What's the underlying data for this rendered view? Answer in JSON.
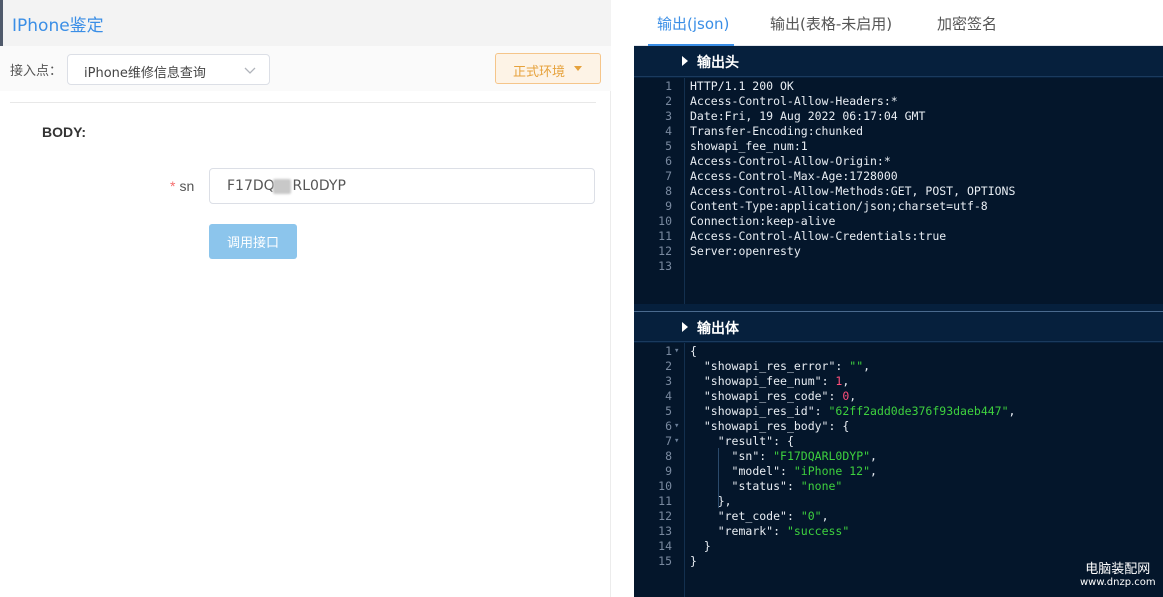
{
  "app": {
    "title": "IPhone鉴定"
  },
  "endpoint": {
    "label": "接入点：",
    "selected": "iPhone维修信息查询"
  },
  "env_button": {
    "label": "正式环境"
  },
  "form": {
    "section_label": "BODY:",
    "required_mark": "*",
    "sn_label": "sn",
    "sn_value": "F17DQ    RL0DYP",
    "submit_label": "调用接口"
  },
  "tabs": [
    "输出(json)",
    "输出(表格-未启用)",
    "加密签名"
  ],
  "output_head": {
    "title": "输出头",
    "lines": [
      "HTTP/1.1 200 OK",
      "Access-Control-Allow-Headers:*",
      "Date:Fri, 19 Aug 2022 06:17:04 GMT",
      "Transfer-Encoding:chunked",
      "showapi_fee_num:1",
      "Access-Control-Allow-Origin:*",
      "Access-Control-Max-Age:1728000",
      "Access-Control-Allow-Methods:GET, POST, OPTIONS",
      "Content-Type:application/json;charset=utf-8",
      "Connection:keep-alive",
      "Access-Control-Allow-Credentials:true",
      "Server:openresty",
      ""
    ]
  },
  "output_body": {
    "title": "输出体",
    "lines": [
      {
        "fold": true,
        "parts": [
          [
            "p",
            "{"
          ]
        ]
      },
      {
        "fold": false,
        "parts": [
          [
            "p",
            "  "
          ],
          [
            "k",
            "\"showapi_res_error\""
          ],
          [
            "p",
            ": "
          ],
          [
            "s",
            "\"\""
          ],
          [
            "p",
            ","
          ]
        ]
      },
      {
        "fold": false,
        "parts": [
          [
            "p",
            "  "
          ],
          [
            "k",
            "\"showapi_fee_num\""
          ],
          [
            "p",
            ": "
          ],
          [
            "n",
            "1"
          ],
          [
            "p",
            ","
          ]
        ]
      },
      {
        "fold": false,
        "parts": [
          [
            "p",
            "  "
          ],
          [
            "k",
            "\"showapi_res_code\""
          ],
          [
            "p",
            ": "
          ],
          [
            "n",
            "0"
          ],
          [
            "p",
            ","
          ]
        ]
      },
      {
        "fold": false,
        "parts": [
          [
            "p",
            "  "
          ],
          [
            "k",
            "\"showapi_res_id\""
          ],
          [
            "p",
            ": "
          ],
          [
            "s",
            "\"62ff2add0de376f93daeb447\""
          ],
          [
            "p",
            ","
          ]
        ]
      },
      {
        "fold": true,
        "parts": [
          [
            "p",
            "  "
          ],
          [
            "k",
            "\"showapi_res_body\""
          ],
          [
            "p",
            ": {"
          ]
        ]
      },
      {
        "fold": true,
        "parts": [
          [
            "p",
            "    "
          ],
          [
            "k",
            "\"result\""
          ],
          [
            "p",
            ": {"
          ]
        ]
      },
      {
        "fold": false,
        "parts": [
          [
            "p",
            "      "
          ],
          [
            "k",
            "\"sn\""
          ],
          [
            "p",
            ": "
          ],
          [
            "s",
            "\"F17DQARL0DYP\""
          ],
          [
            "p",
            ","
          ]
        ]
      },
      {
        "fold": false,
        "parts": [
          [
            "p",
            "      "
          ],
          [
            "k",
            "\"model\""
          ],
          [
            "p",
            ": "
          ],
          [
            "s",
            "\"iPhone 12\""
          ],
          [
            "p",
            ","
          ]
        ]
      },
      {
        "fold": false,
        "parts": [
          [
            "p",
            "      "
          ],
          [
            "k",
            "\"status\""
          ],
          [
            "p",
            ": "
          ],
          [
            "s",
            "\"none\""
          ]
        ]
      },
      {
        "fold": false,
        "parts": [
          [
            "p",
            "    },"
          ]
        ]
      },
      {
        "fold": false,
        "parts": [
          [
            "p",
            "    "
          ],
          [
            "k",
            "\"ret_code\""
          ],
          [
            "p",
            ": "
          ],
          [
            "s",
            "\"0\""
          ],
          [
            "p",
            ","
          ]
        ]
      },
      {
        "fold": false,
        "parts": [
          [
            "p",
            "    "
          ],
          [
            "k",
            "\"remark\""
          ],
          [
            "p",
            ": "
          ],
          [
            "s",
            "\"success\""
          ]
        ]
      },
      {
        "fold": false,
        "parts": [
          [
            "p",
            "  }"
          ]
        ]
      },
      {
        "fold": false,
        "parts": [
          [
            "p",
            "}"
          ]
        ]
      }
    ]
  },
  "watermark": {
    "cn": "电脑装配网",
    "url": "www.dnzp.com"
  },
  "colors": {
    "accent": "#3a8ee6",
    "code_bg": "#04162b",
    "string": "#3ed13e",
    "number": "#ff4f7b",
    "env_orange": "#e6a23c"
  },
  "icons": {
    "select_chevron": "chevron-down-icon",
    "env_caret": "caret-down-icon",
    "section_arrow": "caret-right-icon"
  }
}
